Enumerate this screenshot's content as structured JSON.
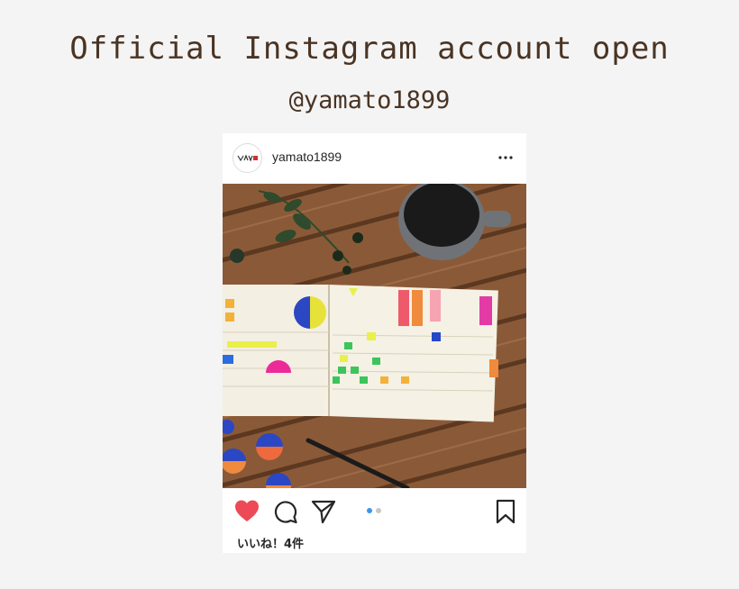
{
  "headline": "Official Instagram account open",
  "handle": "@yamato1899",
  "post": {
    "username": "yamato1899",
    "avatar_icon": "brand-logo-icon",
    "more_icon": "more-options-icon",
    "likes_text": "いいね！4件",
    "carousel": {
      "total": 2,
      "active": 1
    },
    "actions": {
      "like_icon": "heart-icon",
      "comment_icon": "comment-icon",
      "share_icon": "send-icon",
      "bookmark_icon": "bookmark-icon"
    }
  },
  "colors": {
    "headline_text": "#4a3423",
    "like_red": "#ed4956",
    "dot_active": "#3897f0",
    "dot_inactive": "#c7c7c7",
    "icon_dark": "#262626"
  }
}
